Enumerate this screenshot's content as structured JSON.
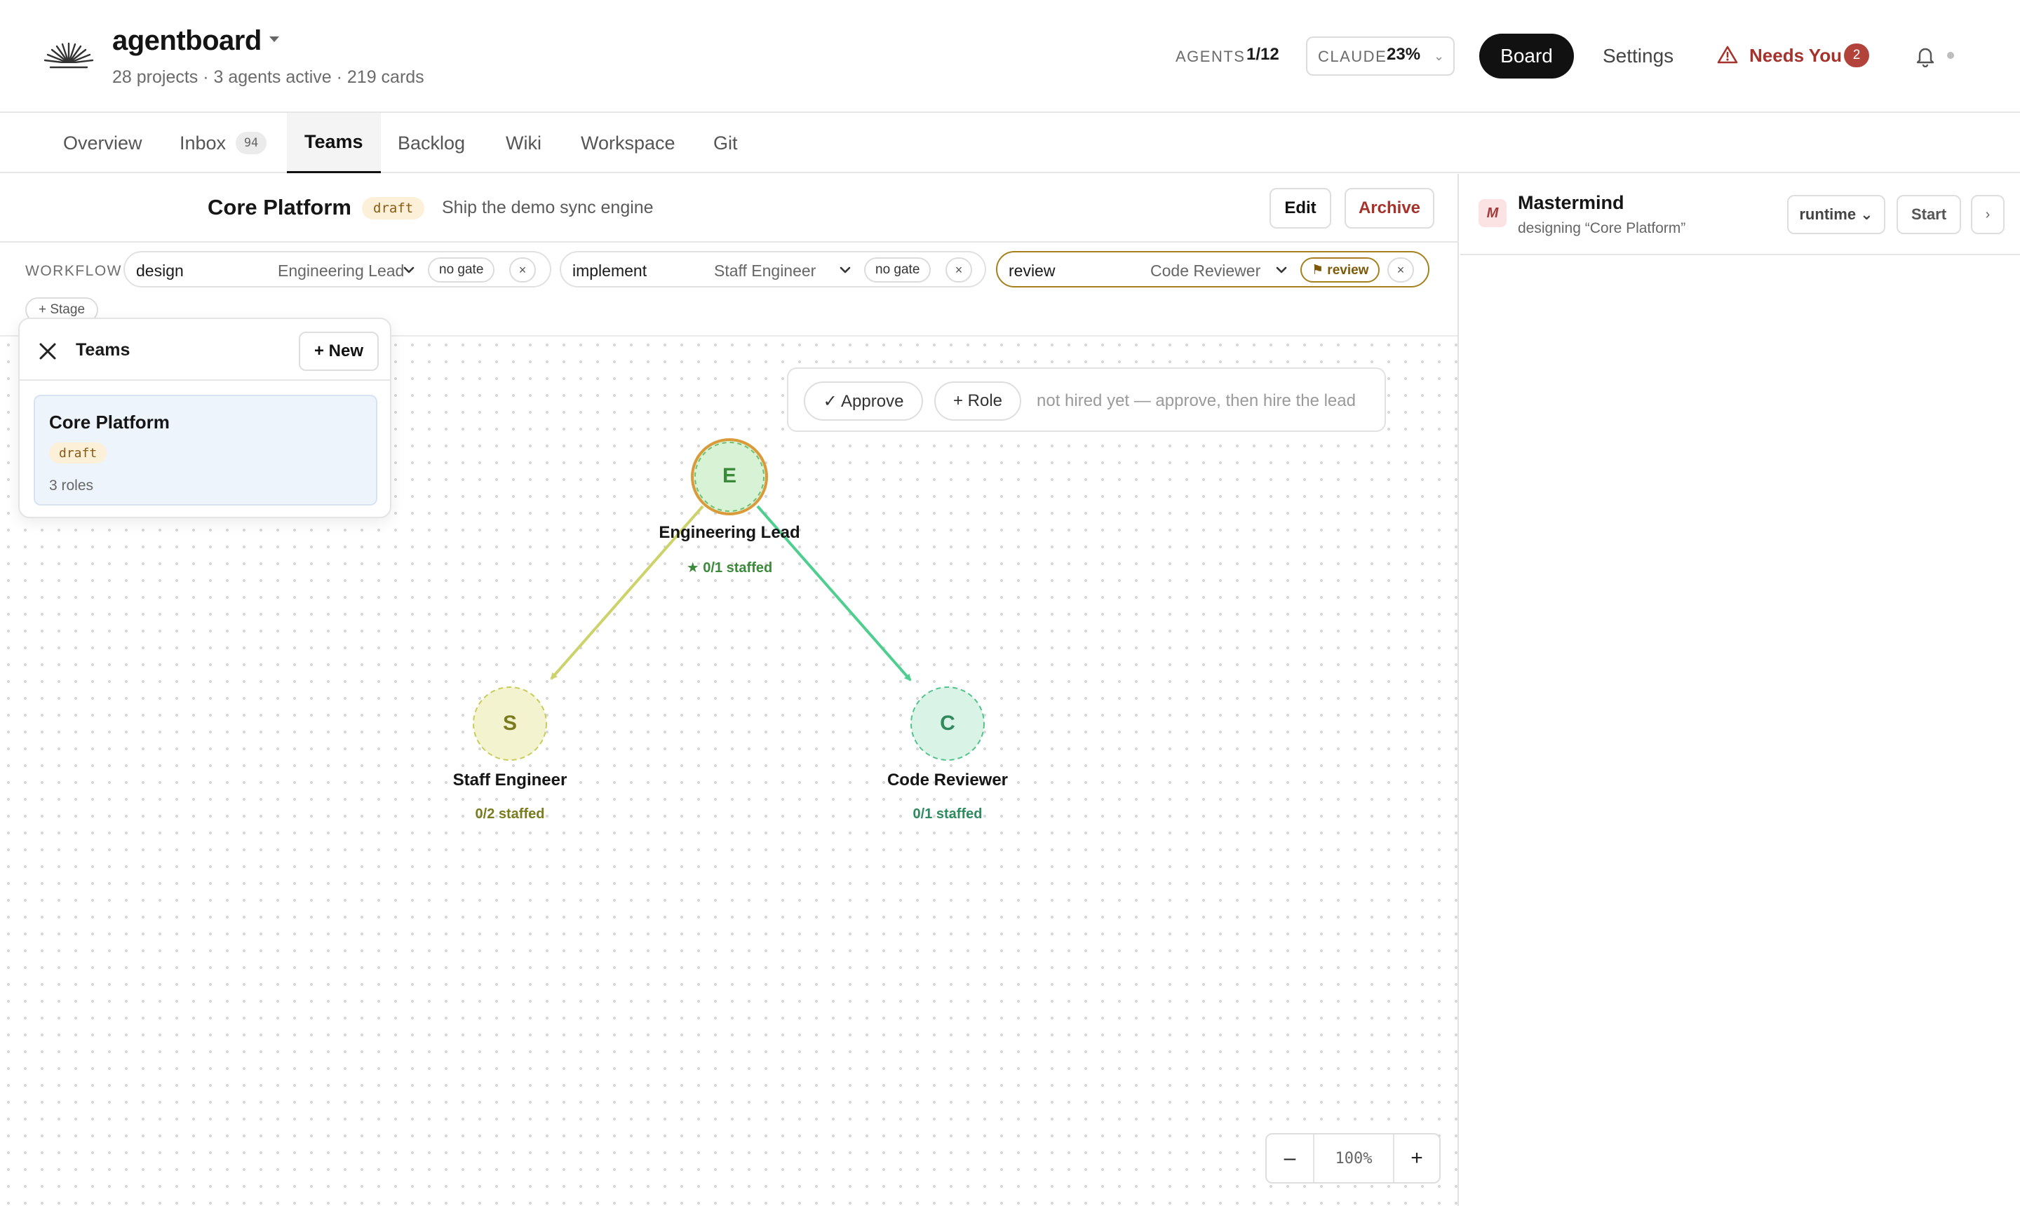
{
  "header": {
    "app_title": "agentboard",
    "app_subtitle": "28 projects · 3 agents active · 219 cards",
    "agents_label": "AGENTS",
    "agents_value": "1/12",
    "claude_label": "CLAUDE",
    "claude_value": "23%",
    "claude_caret": "⌄",
    "board_label": "Board",
    "settings_label": "Settings",
    "needs_label": "Needs You",
    "needs_count": "2",
    "icons": {
      "logo": "sunburst-logo-icon",
      "needs": "warning-triangle-icon",
      "bell": "bell-icon"
    }
  },
  "tabs": [
    {
      "label": "Overview"
    },
    {
      "label": "Inbox",
      "count": "94"
    },
    {
      "label": "Teams",
      "active": true
    },
    {
      "label": "Backlog"
    },
    {
      "label": "Wiki"
    },
    {
      "label": "Workspace"
    },
    {
      "label": "Git"
    }
  ],
  "team": {
    "name": "Core Platform",
    "status": "draft",
    "description": "Ship the demo sync engine",
    "edit_label": "Edit",
    "archive_label": "Archive"
  },
  "workflow": {
    "label": "WORKFLOW",
    "stages": [
      {
        "name": "design",
        "role": "Engineering Lead",
        "gate": "no gate",
        "remove": "×"
      },
      {
        "name": "implement",
        "role": "Staff Engineer",
        "gate": "no gate",
        "remove": "×"
      },
      {
        "name": "review",
        "role": "Code Reviewer",
        "gate": "⚑ review",
        "remove": "×",
        "highlighted": true
      }
    ],
    "add_stage_label": "+ Stage"
  },
  "teams_panel": {
    "title": "Teams",
    "new_label": "+ New",
    "items": [
      {
        "name": "Core Platform",
        "status": "draft",
        "roles": "3 roles"
      }
    ]
  },
  "action_bar": {
    "approve_label": "✓ Approve",
    "role_label": "+ Role",
    "hint": "not hired yet — approve, then hire the lead"
  },
  "org_chart": {
    "nodes": [
      {
        "id": "E",
        "letter": "E",
        "name": "Engineering Lead",
        "staffed": "★ 0/1 staffed",
        "color": "#3a8a3a"
      },
      {
        "id": "S",
        "letter": "S",
        "name": "Staff Engineer",
        "staffed": "0/2 staffed",
        "color": "#7a7a1e"
      },
      {
        "id": "C",
        "letter": "C",
        "name": "Code Reviewer",
        "staffed": "0/1 staffed",
        "color": "#2f8a5f"
      }
    ],
    "edges": [
      {
        "from": "E",
        "to": "S",
        "color": "#cdd36a"
      },
      {
        "from": "E",
        "to": "C",
        "color": "#4fcf8f"
      }
    ]
  },
  "zoom": {
    "out": "–",
    "value": "100%",
    "in": "+"
  },
  "right_panel": {
    "avatar_letter": "M",
    "name": "Mastermind",
    "subtitle": "designing “Core Platform”",
    "runtime_label": "runtime ⌄",
    "start_label": "Start",
    "expand_label": "›"
  },
  "colors": {
    "accent": "#111111",
    "danger": "#a5322b",
    "review_gate": "#a4801e",
    "draft_bg": "#fdf0d8"
  }
}
